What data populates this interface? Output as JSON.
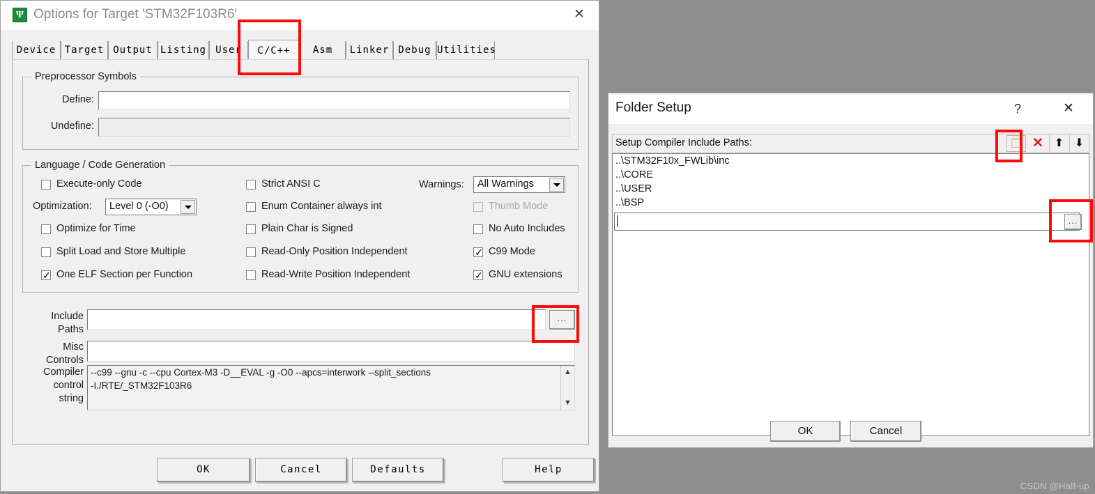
{
  "options_dialog": {
    "title": "Options for Target 'STM32F103R6'",
    "icon": "uvision-icon",
    "close_label": "✕",
    "tabs": [
      {
        "label": "Device",
        "active": false
      },
      {
        "label": "Target",
        "active": false
      },
      {
        "label": "Output",
        "active": false
      },
      {
        "label": "Listing",
        "active": false
      },
      {
        "label": "User",
        "active": false
      },
      {
        "label": "C/C++",
        "active": true
      },
      {
        "label": "Asm",
        "active": false
      },
      {
        "label": "Linker",
        "active": false
      },
      {
        "label": "Debug",
        "active": false
      },
      {
        "label": "Utilities",
        "active": false
      }
    ],
    "preprocessor": {
      "group_label": "Preprocessor Symbols",
      "define_label": "Define:",
      "define_value": "",
      "undefine_label": "Undefine:",
      "undefine_value": ""
    },
    "language": {
      "group_label": "Language / Code Generation",
      "left_checks": [
        {
          "label": "Execute-only Code",
          "checked": false,
          "disabled": false
        },
        {
          "label": "Optimize for Time",
          "checked": false,
          "disabled": false
        },
        {
          "label": "Split Load and Store Multiple",
          "checked": false,
          "disabled": false
        },
        {
          "label": "One ELF Section per Function",
          "checked": true,
          "disabled": false
        }
      ],
      "optimization_label": "Optimization:",
      "optimization_value": "Level 0 (-O0)",
      "mid_checks": [
        {
          "label": "Strict ANSI C",
          "checked": false,
          "disabled": false
        },
        {
          "label": "Enum Container always int",
          "checked": false,
          "disabled": false
        },
        {
          "label": "Plain Char is Signed",
          "checked": false,
          "disabled": false
        },
        {
          "label": "Read-Only Position Independent",
          "checked": false,
          "disabled": false
        },
        {
          "label": "Read-Write Position Independent",
          "checked": false,
          "disabled": false
        }
      ],
      "warnings_label": "Warnings:",
      "warnings_value": "All Warnings",
      "right_checks": [
        {
          "label": "Thumb Mode",
          "checked": false,
          "disabled": true
        },
        {
          "label": "No Auto Includes",
          "checked": false,
          "disabled": false
        },
        {
          "label": "C99 Mode",
          "checked": true,
          "disabled": false
        },
        {
          "label": "GNU extensions",
          "checked": true,
          "disabled": false
        }
      ]
    },
    "paths": {
      "include_label_line1": "Include",
      "include_label_line2": "Paths",
      "include_value": "",
      "include_browse_label": "...",
      "misc_label_line1": "Misc",
      "misc_label_line2": "Controls",
      "misc_value": "",
      "cc_label_line1": "Compiler",
      "cc_label_line2": "control",
      "cc_label_line3": "string",
      "cc_line1": "--c99 --gnu -c --cpu Cortex-M3 -D__EVAL -g -O0 --apcs=interwork --split_sections",
      "cc_line2": "-I./RTE/_STM32F103R6",
      "scroll_up": "▲",
      "scroll_down": "▼"
    },
    "buttons": [
      {
        "label": "OK"
      },
      {
        "label": "Cancel"
      },
      {
        "label": "Defaults"
      },
      {
        "label": "Help"
      }
    ]
  },
  "folder_dialog": {
    "title": "Folder Setup",
    "help_label": "?",
    "close_label": "✕",
    "toolbar_caption": "Setup Compiler Include Paths:",
    "toolbar_buttons": [
      {
        "name": "new-folder-icon",
        "glyph": "❐"
      },
      {
        "name": "delete-icon",
        "glyph": "✕"
      },
      {
        "name": "move-up-icon",
        "glyph": "⬆"
      },
      {
        "name": "move-down-icon",
        "glyph": "⬇"
      }
    ],
    "paths": [
      "..\\STM32F10x_FWLib\\inc",
      "..\\CORE",
      "..\\USER",
      "..\\BSP"
    ],
    "edit_value": "",
    "edit_browse_label": "...",
    "buttons": [
      {
        "label": "OK"
      },
      {
        "label": "Cancel"
      }
    ]
  },
  "annotations": {
    "highlight_color": "#fb0b0b",
    "boxes": [
      "tab-cpp-highlight",
      "include-paths-browse-highlight",
      "new-folder-button-highlight",
      "path-edit-browse-highlight"
    ]
  },
  "watermark": "CSDN @Half-up"
}
